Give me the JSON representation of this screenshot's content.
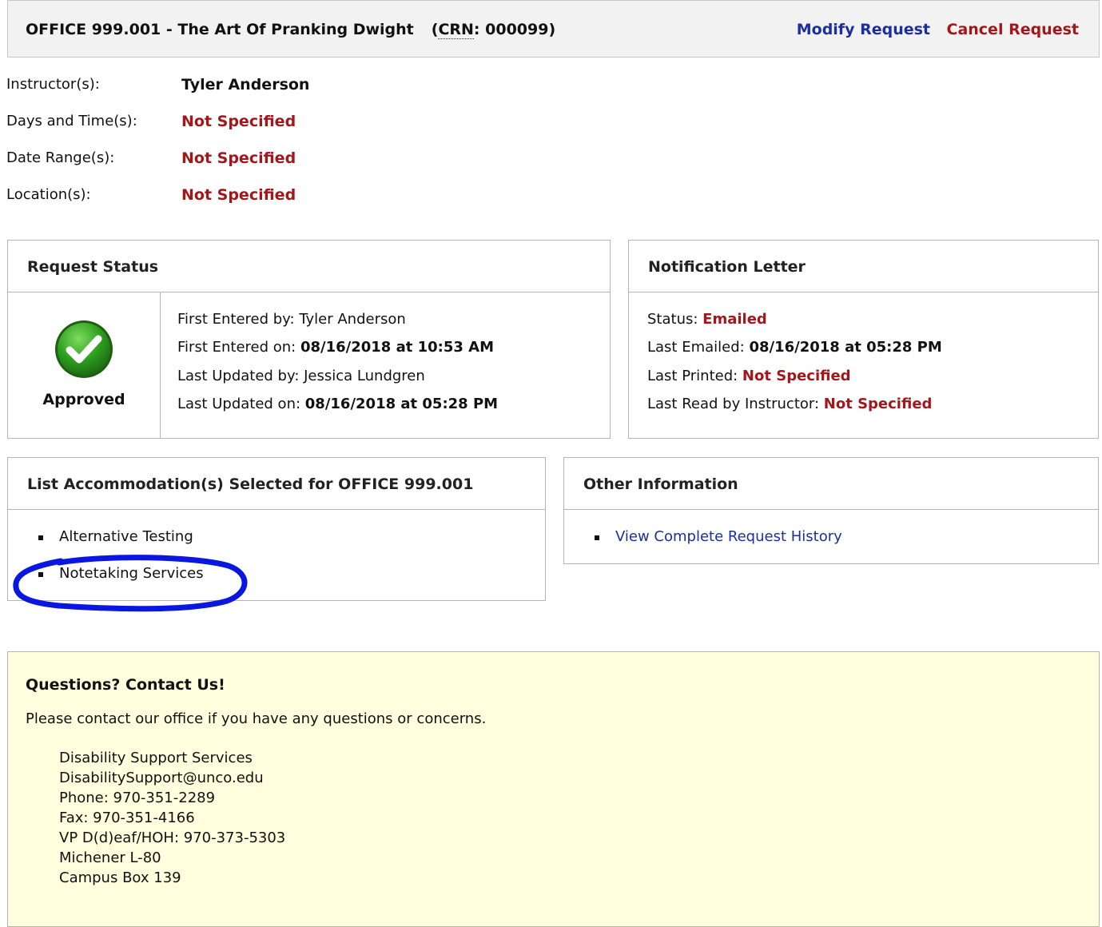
{
  "header": {
    "course": "OFFICE 999.001 - The Art Of Pranking Dwight",
    "crn_prefix": "(",
    "crn_abbr": "CRN",
    "crn_value": ": 000099)",
    "modify_label": "Modify Request",
    "cancel_label": "Cancel Request"
  },
  "details": [
    {
      "label": "Instructor(s):",
      "value": "Tyler Anderson"
    },
    {
      "label": "Days and Time(s):",
      "value": "Not Specified"
    },
    {
      "label": "Date Range(s):",
      "value": "Not Specified"
    },
    {
      "label": "Location(s):",
      "value": "Not Specified"
    }
  ],
  "request_status": {
    "title": "Request Status",
    "status": "Approved",
    "first_entered_by_label": "First Entered by:",
    "first_entered_by": "Tyler Anderson",
    "first_entered_on_label": "First Entered on:",
    "first_entered_on": "08/16/2018 at 10:53 AM",
    "last_updated_by_label": "Last Updated by:",
    "last_updated_by": "Jessica Lundgren",
    "last_updated_on_label": "Last Updated on:",
    "last_updated_on": "08/16/2018 at 05:28 PM"
  },
  "notification": {
    "title": "Notification Letter",
    "status_label": "Status:",
    "status": "Emailed",
    "last_emailed_label": "Last Emailed:",
    "last_emailed": "08/16/2018 at 05:28 PM",
    "last_printed_label": "Last Printed:",
    "last_printed": "Not Specified",
    "last_read_label": "Last Read by Instructor:",
    "last_read": "Not Specified"
  },
  "accommodations": {
    "title": "List Accommodation(s) Selected for OFFICE 999.001",
    "items": [
      "Alternative Testing",
      "Notetaking Services"
    ]
  },
  "other_info": {
    "title": "Other Information",
    "link": "View Complete Request History"
  },
  "contact": {
    "title": "Questions? Contact Us!",
    "intro": "Please contact our office if you have any questions or concerns.",
    "lines": [
      "Disability Support Services",
      "DisabilitySupport@unco.edu",
      "Phone: 970-351-2289",
      "Fax: 970-351-4166",
      "VP D(d)eaf/HOH: 970-373-5303",
      "Michener L-80",
      "Campus Box 139"
    ]
  },
  "colors": {
    "link_blue": "#1c2fa0",
    "alert_red": "#a4161a",
    "approved_green": "#2e9e1f",
    "contact_bg": "#ffffdd",
    "annotation_blue": "#0a17e0"
  }
}
